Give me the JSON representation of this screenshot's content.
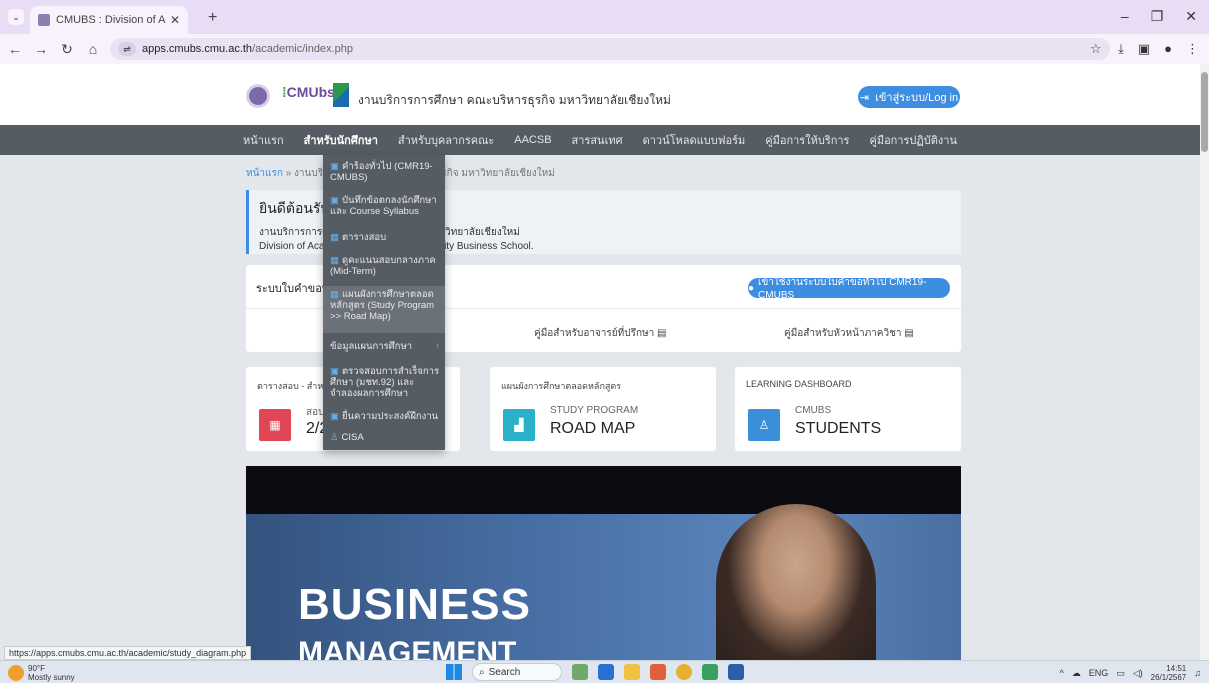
{
  "browser": {
    "tab_title": "CMUBS : Division of Academic",
    "url_host": "apps.cmubs.cmu.ac.th",
    "url_path": "/academic/index.php",
    "status_url": "https://apps.cmubs.cmu.ac.th/academic/study_diagram.php"
  },
  "header": {
    "logo_text": "CMU",
    "logo_sub": "bs",
    "site_title": "งานบริการการศึกษา คณะบริหารธุรกิจ มหาวิทยาลัยเชียงใหม่",
    "login_label": "เข้าสู่ระบบ/Log in"
  },
  "menu": {
    "items": [
      {
        "label": "หน้าแรก"
      },
      {
        "label": "สำหรับนักศึกษา"
      },
      {
        "label": "สำหรับบุคลากรคณะ"
      },
      {
        "label": "AACSB"
      },
      {
        "label": "สารสนเทศ"
      },
      {
        "label": "ดาวน์โหลดแบบฟอร์ม"
      },
      {
        "label": "คู่มือการให้บริการ"
      },
      {
        "label": "คู่มือการปฏิบัติงาน"
      }
    ]
  },
  "dropdown": {
    "items": [
      {
        "label": "คำร้องทั่วไป (CMR19-CMUBS)"
      },
      {
        "label": "บันทึกข้อตกลงนักศึกษาและ Course Syllabus"
      },
      {
        "label": "ตารางสอบ"
      },
      {
        "label": "ดูคะแนนสอบกลางภาค (Mid-Term)"
      },
      {
        "label": "แผนผังการศึกษาตลอดหลักสูตร (Study Program >> Road Map)"
      },
      {
        "label": "ข้อมูลแผนการศึกษา"
      },
      {
        "label": "ตรวจสอบการสำเร็จการศึกษา (มชท.92) และจำลองผลการศึกษา"
      },
      {
        "label": "ยื่นความประสงค์ฝึกงาน"
      },
      {
        "label": "CISA"
      }
    ]
  },
  "breadcrumb": {
    "home": "หน้าแรก",
    "sep": "»",
    "rest": "งานบริการการศึกษา คณะบริหารธุรกิจ มหาวิทยาลัยเชียงใหม่"
  },
  "welcome": {
    "title": "ยินดีต้อนรับ",
    "line1": "งานบริการการศึกษา คณะบริหารธุรกิจ มหาวิทยาลัยเชียงใหม่",
    "line2": "Division of Academic, Chiang Mai University Business School."
  },
  "request_panel": {
    "title": "ระบบใบคำขอทั่วไป",
    "button": "เข้าใช้งานระบบใบคำขอทั่วไป CMR19-CMUBS",
    "guide_advisor": "คู่มือสำหรับอาจารย์ที่ปรึกษา",
    "guide_head": "คู่มือสำหรับหัวหน้าภาควิชา"
  },
  "cards": [
    {
      "title": "ตารางสอบ - สำหรับนักศึกษา",
      "sub": "สอบ",
      "big": "2/2",
      "color": "#e04655",
      "icon": "calendar-icon"
    },
    {
      "title": "แผนผังการศึกษาตลอดหลักสูตร",
      "sub": "STUDY PROGRAM",
      "big": "ROAD MAP",
      "color": "#2ab0c8",
      "icon": "chart-icon"
    },
    {
      "title": "LEARNING DASHBOARD",
      "sub": "CMUBS",
      "big": "STUDENTS",
      "color": "#3a8fd8",
      "icon": "user-icon"
    }
  ],
  "banner": {
    "line1": "BUSINESS",
    "line2": "MANAGEMENT"
  },
  "taskbar": {
    "temp": "90°F",
    "weather": "Mostly sunny",
    "search": "Search",
    "lang": "ENG",
    "time": "14:51",
    "date": "26/1/2567"
  }
}
